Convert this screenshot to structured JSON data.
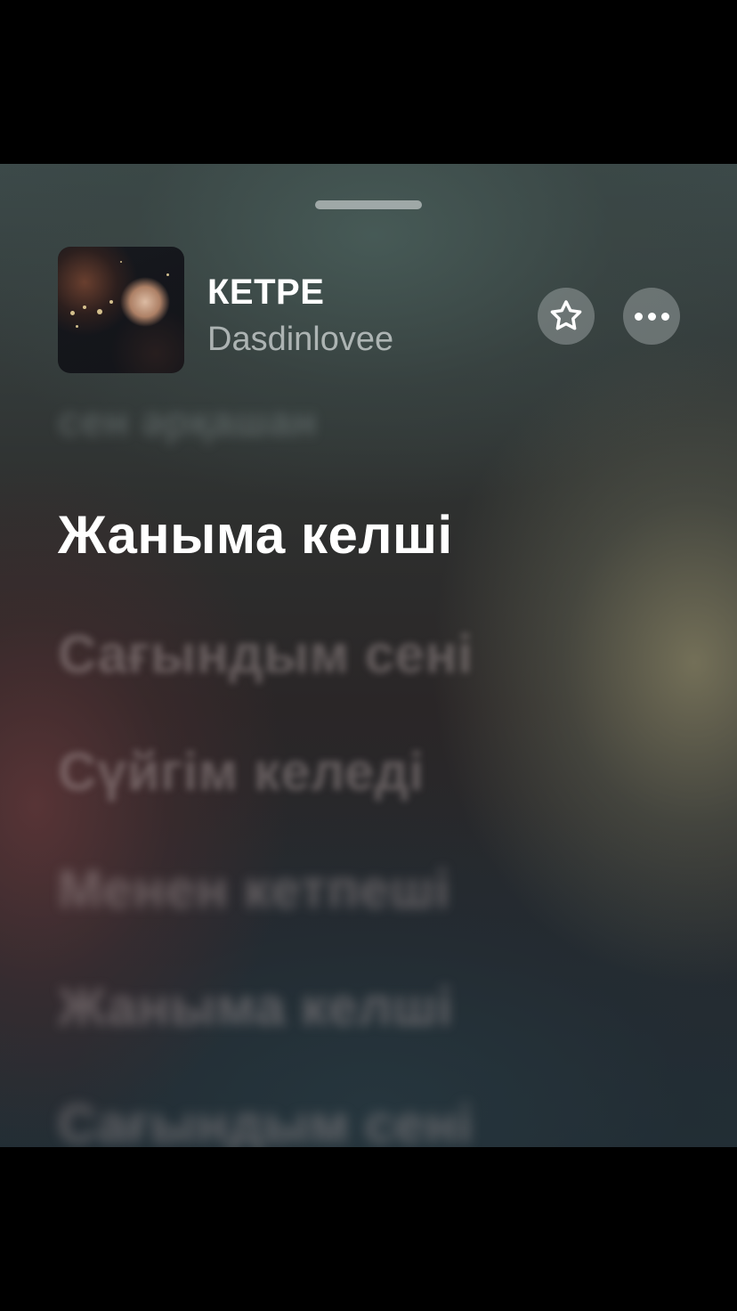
{
  "now_playing": {
    "title": "КЕТРЕ",
    "artist": "Dasdinlovee"
  },
  "controls": {
    "favorite_icon": "star-icon",
    "more_icon": "ellipsis-icon"
  },
  "lyrics": {
    "past": "сен әрқашан",
    "current": "Жаныма келші",
    "upcoming": [
      "Сағындым сені",
      "Сүйгім келеді",
      "Менен кетпеші",
      "Жаныма келші",
      "Сағындым сені"
    ]
  },
  "colors": {
    "current_lyric": "#ffffff",
    "button_bg": "#8f9595"
  }
}
